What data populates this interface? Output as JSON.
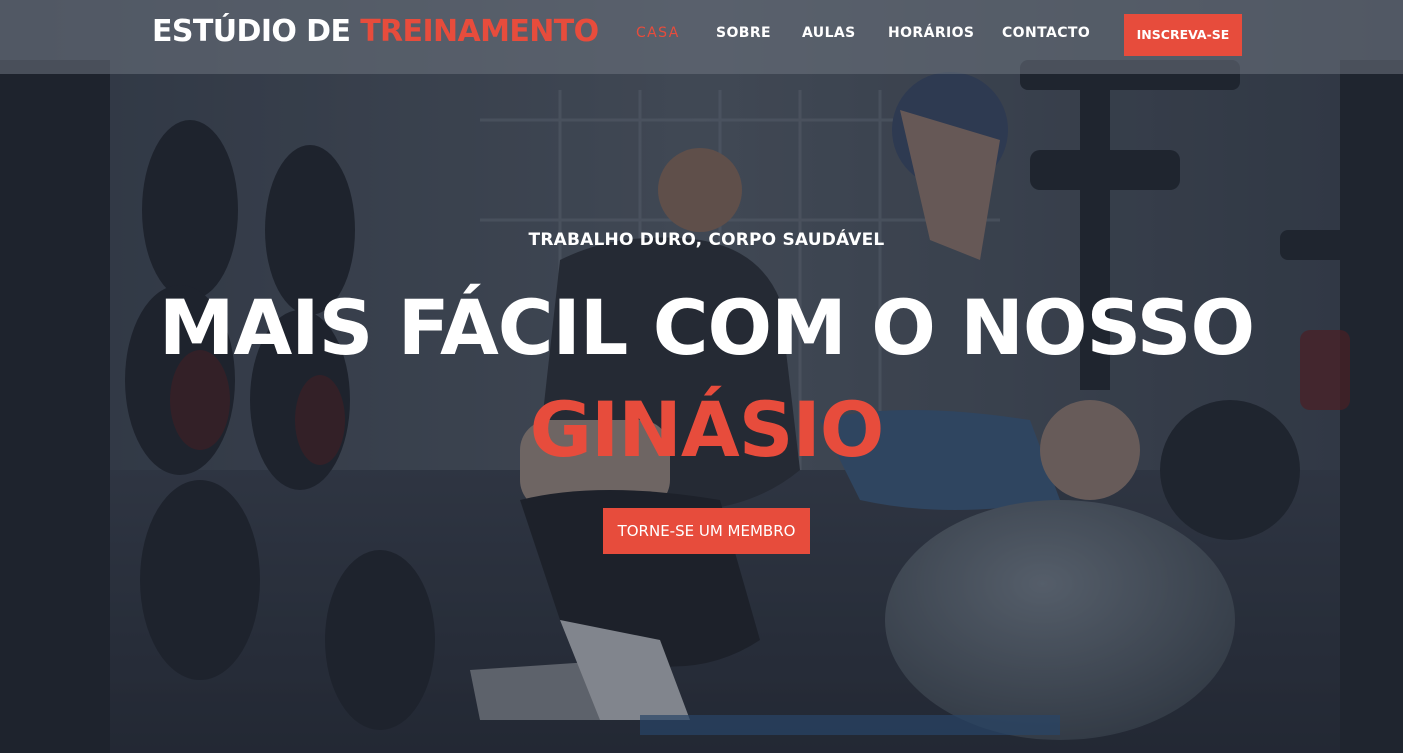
{
  "header": {
    "logo_main": "ESTÚDIO DE ",
    "logo_accent": "TREINAMENTO",
    "nav": [
      {
        "label": "CASA",
        "active": true
      },
      {
        "label": "SOBRE",
        "active": false
      },
      {
        "label": "AULAS",
        "active": false
      },
      {
        "label": "HORÁRIOS",
        "active": false
      },
      {
        "label": "CONTACTO",
        "active": false
      }
    ],
    "signup_label": "INSCREVA-SE"
  },
  "hero": {
    "tagline": "TRABALHO DURO, CORPO SAUDÁVEL",
    "headline": "MAIS FÁCIL COM O NOSSO",
    "headline_accent": "GINÁSIO",
    "cta_label": "TORNE-SE UM MEMBRO"
  },
  "colors": {
    "accent": "#e74c3c",
    "text": "#ffffff",
    "header_bg": "rgba(110,116,128,0.55)"
  }
}
